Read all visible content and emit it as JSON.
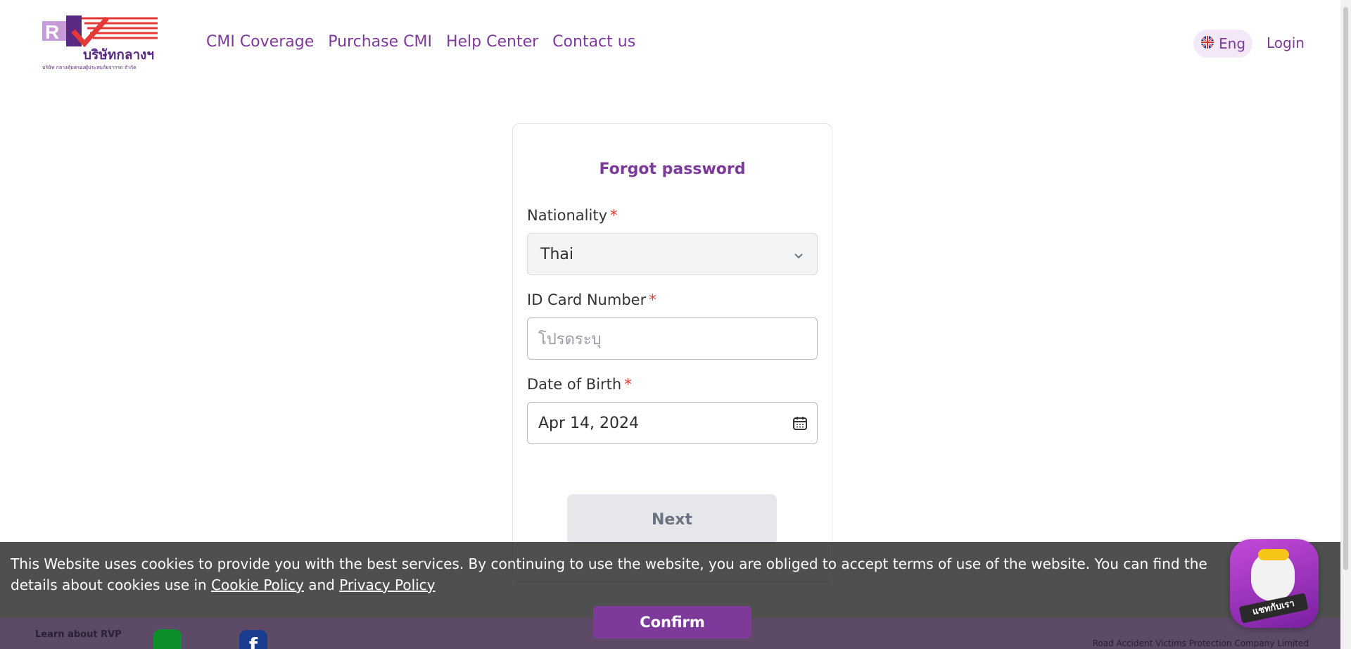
{
  "brand": {
    "logo_text": "บริษัทกลางฯ",
    "logo_subtext": "บริษัท กลางคุ้มครองผู้ประสบภัยจากรถ จำกัด"
  },
  "nav": {
    "items": [
      {
        "label": "CMI Coverage"
      },
      {
        "label": "Purchase CMI"
      },
      {
        "label": "Help Center"
      },
      {
        "label": "Contact us"
      }
    ],
    "language": "Eng",
    "login": "Login"
  },
  "form": {
    "title": "Forgot password",
    "nationality": {
      "label": "Nationality",
      "required": "*",
      "value": "Thai"
    },
    "id_card": {
      "label": "ID Card Number",
      "required": "*",
      "placeholder": "โปรดระบุ"
    },
    "dob": {
      "label": "Date of Birth",
      "required": "*",
      "value": "Apr 14, 2024"
    },
    "next_button": "Next"
  },
  "cookie_banner": {
    "text_1": "This Website uses cookies to provide you with the best services. By continuing to use the website, you are obliged to accept terms of use of the website. You can find the details about cookies use in ",
    "cookie_policy_link": "Cookie Policy",
    "and": " and ",
    "privacy_policy_link": "Privacy Policy",
    "confirm_button": "Confirm"
  },
  "footer": {
    "learn": "Learn about RVP",
    "company": "Road Accident Victims Protection Company Limited",
    "line_label": "LINE",
    "facebook_label": "f"
  },
  "chat_widget": {
    "label": "แชทกับเรา"
  },
  "colors": {
    "brand_purple": "#7e3a9b",
    "required_red": "#e53935"
  }
}
